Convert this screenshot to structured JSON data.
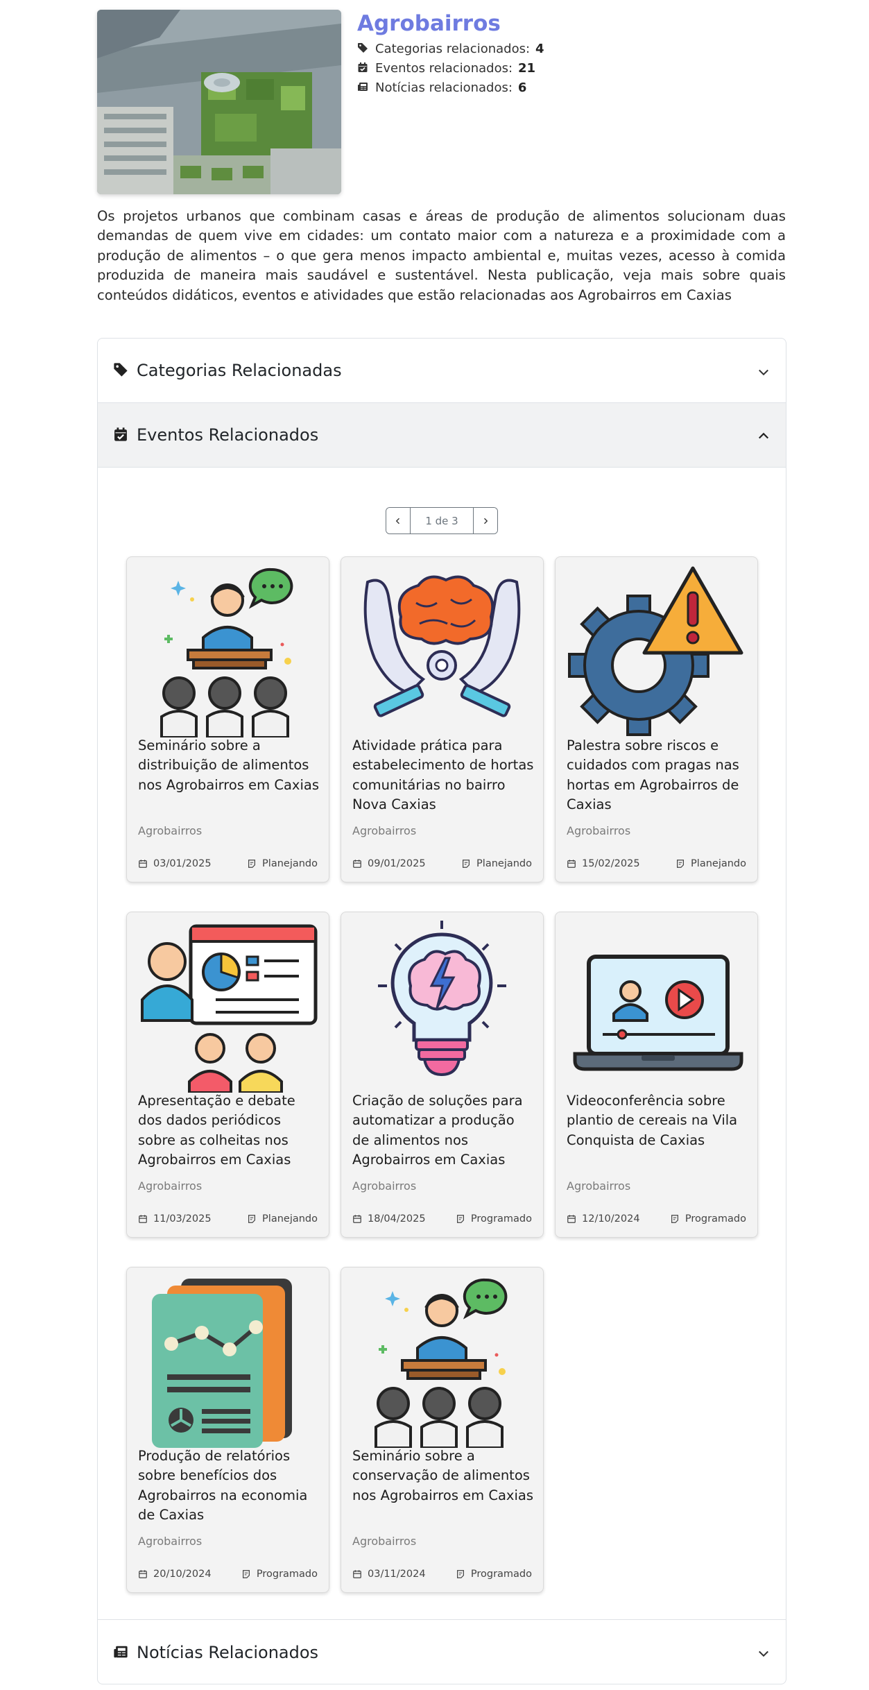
{
  "header": {
    "title": "Agrobairros",
    "stats": [
      {
        "label": "Categorias relacionados:",
        "value": "4",
        "icon": "tag-icon"
      },
      {
        "label": "Eventos relacionados:",
        "value": "21",
        "icon": "calendar-check-icon"
      },
      {
        "label": "Notícias relacionados:",
        "value": "6",
        "icon": "newspaper-icon"
      }
    ]
  },
  "description": "Os projetos urbanos que combinam casas e áreas de produção de alimentos solucionam duas demandas de quem vive em cidades: um contato maior com a natureza e a proximidade com a produção de alimentos – o que gera menos impacto ambiental e, muitas vezes, acesso à comida produzida de maneira mais saudável e sustentável. Nesta publicação, veja mais sobre quais conteúdos didáticos, eventos e atividades que estão relacionadas aos Agrobairros em Caxias",
  "accordion": {
    "categories_label": "Categorias Relacionadas",
    "events_label": "Eventos Relacionados",
    "news_label": "Notícias Relacionados"
  },
  "pagination": {
    "label": "1 de 3"
  },
  "events": [
    {
      "title": "Seminário sobre a distribuição de alimentos nos Agrobairros em Caxias",
      "category": "Agrobairros",
      "date": "03/01/2025",
      "status": "Planejando",
      "image": "seminar-illustration"
    },
    {
      "title": "Atividade prática para estabelecimento de hortas comunitárias no bairro Nova Caxias",
      "category": "Agrobairros",
      "date": "09/01/2025",
      "status": "Planejando",
      "image": "brain-hands-illustration"
    },
    {
      "title": "Palestra sobre riscos e cuidados com pragas nas hortas em Agrobairros de Caxias",
      "category": "Agrobairros",
      "date": "15/02/2025",
      "status": "Planejando",
      "image": "gear-warning-illustration"
    },
    {
      "title": "Apresentação e debate dos dados periódicos sobre as colheitas nos Agrobairros em Caxias",
      "category": "Agrobairros",
      "date": "11/03/2025",
      "status": "Planejando",
      "image": "presentation-illustration"
    },
    {
      "title": "Criação de soluções para automatizar a produção de alimentos nos Agrobairros em Caxias",
      "category": "Agrobairros",
      "date": "18/04/2025",
      "status": "Programado",
      "image": "lightbulb-brain-illustration"
    },
    {
      "title": "Videoconferência sobre plantio de cereais na Vila Conquista de Caxias",
      "category": "Agrobairros",
      "date": "12/10/2024",
      "status": "Programado",
      "image": "laptop-video-illustration"
    },
    {
      "title": "Produção de relatórios sobre benefícios dos Agrobairros na economia de Caxias",
      "category": "Agrobairros",
      "date": "20/10/2024",
      "status": "Programado",
      "image": "reports-illustration"
    },
    {
      "title": "Seminário sobre a conservação de alimentos nos Agrobairros em Caxias",
      "category": "Agrobairros",
      "date": "03/11/2024",
      "status": "Programado",
      "image": "seminar-illustration"
    }
  ]
}
